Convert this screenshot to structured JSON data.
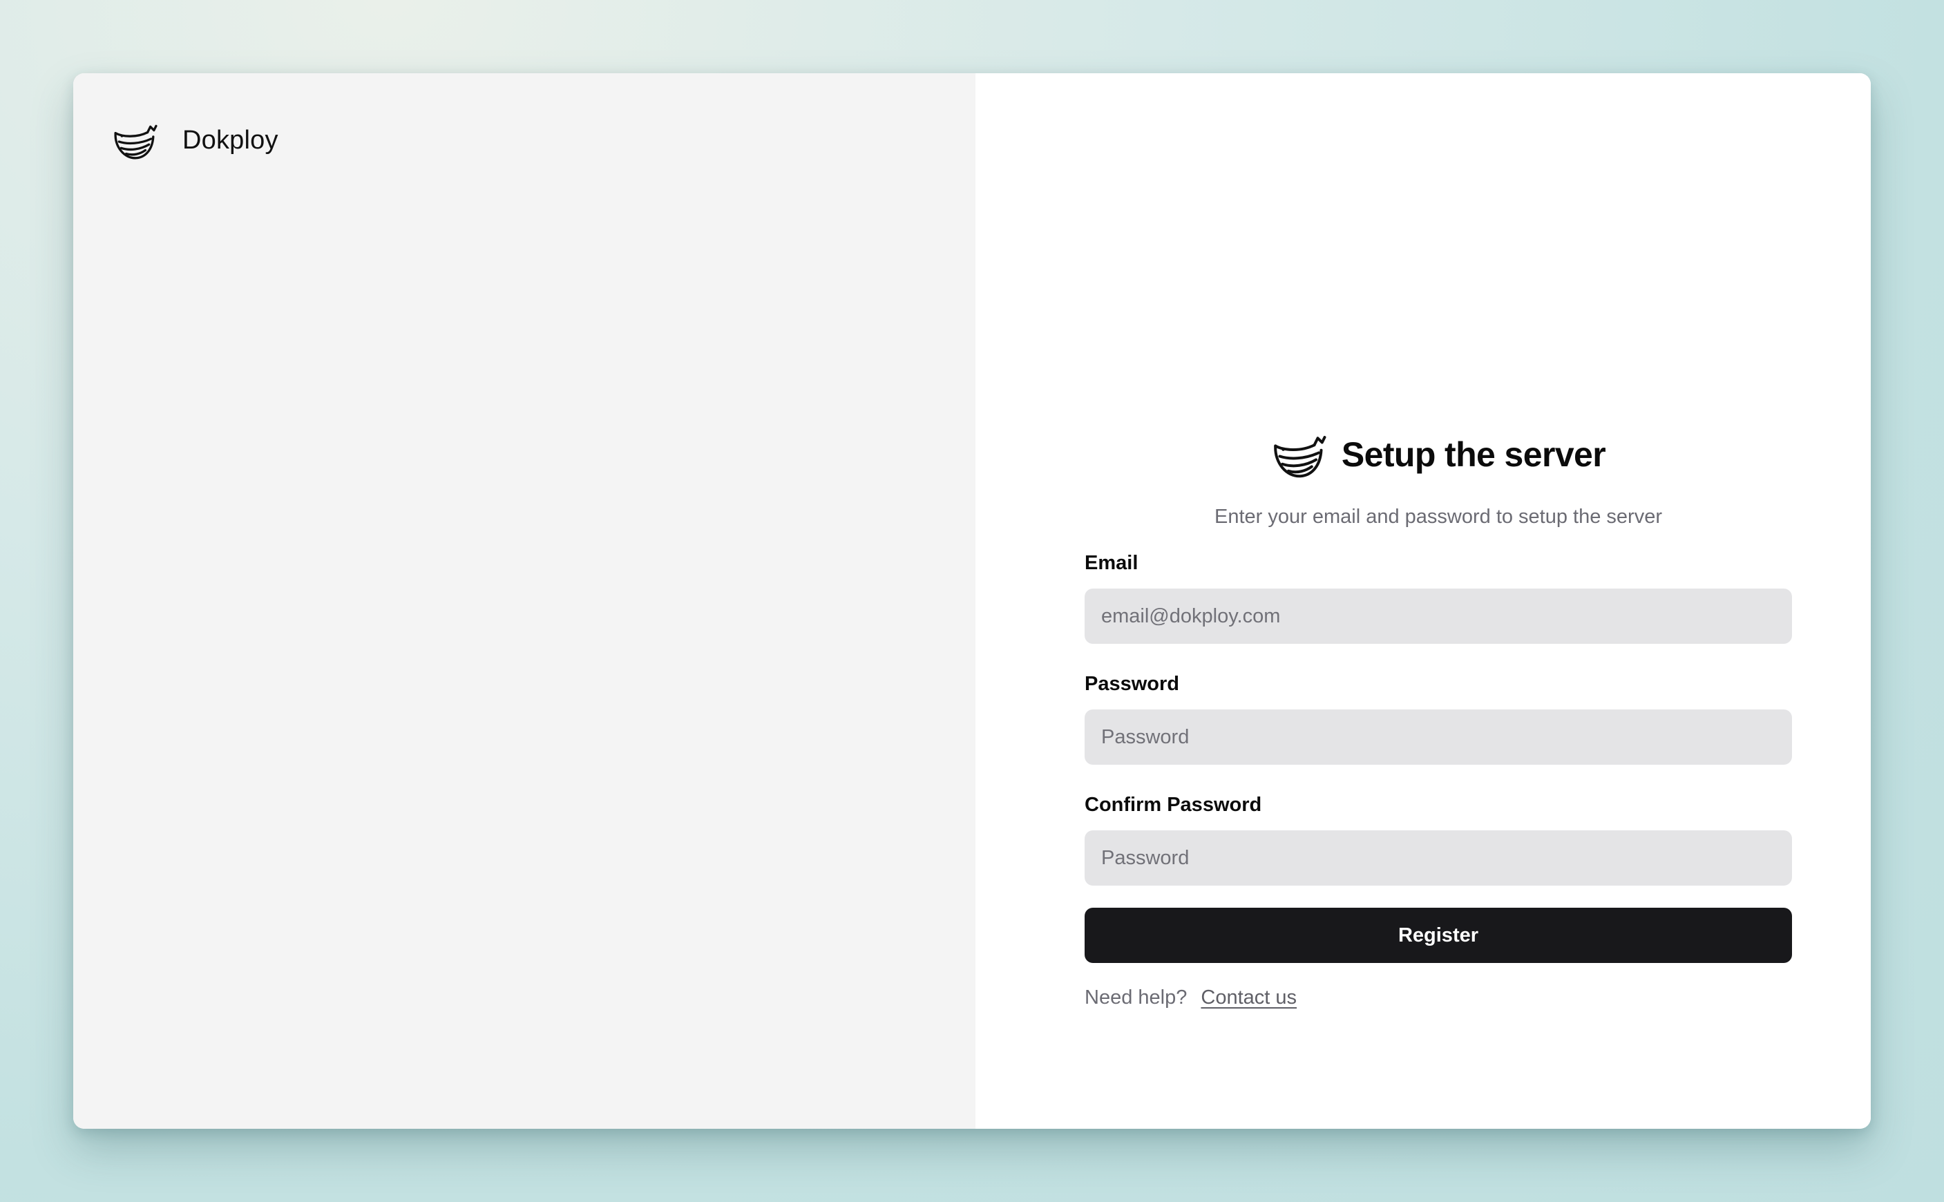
{
  "brand": {
    "name": "Dokploy",
    "logo_icon": "dokploy-whale-icon"
  },
  "setup": {
    "title": "Setup the server",
    "subtitle": "Enter your email and password to setup the server",
    "email": {
      "label": "Email",
      "placeholder": "email@dokploy.com",
      "value": ""
    },
    "password": {
      "label": "Password",
      "placeholder": "Password",
      "value": ""
    },
    "confirm_password": {
      "label": "Confirm Password",
      "placeholder": "Password",
      "value": ""
    },
    "register_label": "Register",
    "help_text": "Need help?",
    "contact_label": "Contact us"
  },
  "colors": {
    "primary_button": "#18181b",
    "input_background": "#e4e4e6",
    "left_panel_background": "#f4f4f4",
    "muted_text": "#6b6b73"
  }
}
